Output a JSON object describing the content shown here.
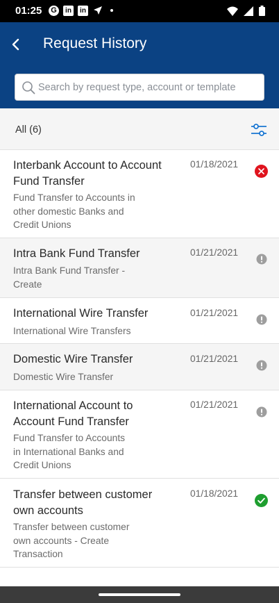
{
  "status_bar": {
    "time": "01:25",
    "left_icons": [
      "google-icon",
      "linkedin-icon",
      "linkedin-icon",
      "navigation-arrow-icon",
      "dot-icon"
    ],
    "right_icons": [
      "wifi-icon",
      "signal-icon",
      "battery-icon"
    ]
  },
  "header": {
    "title": "Request History",
    "back_icon": "chevron-left-icon",
    "background": "#0b4283"
  },
  "search": {
    "placeholder": "Search by request type, account or template"
  },
  "filter": {
    "label": "All (6)",
    "icon": "sliders-icon",
    "accent": "#1976d2"
  },
  "requests": [
    {
      "title_lines": [
        "Interbank Account to Account",
        "Fund Transfer"
      ],
      "subtitle_lines": [
        "Fund Transfer to Accounts in",
        "other domestic Banks and",
        "Credit Unions"
      ],
      "date": "01/18/2021",
      "status": "rejected",
      "status_color": "#e0141e"
    },
    {
      "title_lines": [
        "Intra Bank Fund Transfer"
      ],
      "subtitle_lines": [
        "Intra Bank Fund Transfer -",
        "Create"
      ],
      "date": "01/21/2021",
      "status": "pending",
      "status_color": "#9e9e9e"
    },
    {
      "title_lines": [
        "International Wire Transfer"
      ],
      "subtitle_lines": [
        "International Wire Transfers"
      ],
      "date": "01/21/2021",
      "status": "pending",
      "status_color": "#9e9e9e"
    },
    {
      "title_lines": [
        "Domestic Wire Transfer"
      ],
      "subtitle_lines": [
        "Domestic Wire Transfer"
      ],
      "date": "01/21/2021",
      "status": "pending",
      "status_color": "#9e9e9e"
    },
    {
      "title_lines": [
        "International Account to",
        "Account Fund Transfer"
      ],
      "subtitle_lines": [
        "Fund Transfer to Accounts",
        "in International Banks and",
        "Credit Unions"
      ],
      "date": "01/21/2021",
      "status": "pending",
      "status_color": "#9e9e9e"
    },
    {
      "title_lines": [
        "Transfer between customer",
        "own accounts"
      ],
      "subtitle_lines": [
        "Transfer between customer",
        "own accounts - Create",
        "Transaction"
      ],
      "date": "01/18/2021",
      "status": "completed",
      "status_color": "#1e9e2f"
    }
  ]
}
